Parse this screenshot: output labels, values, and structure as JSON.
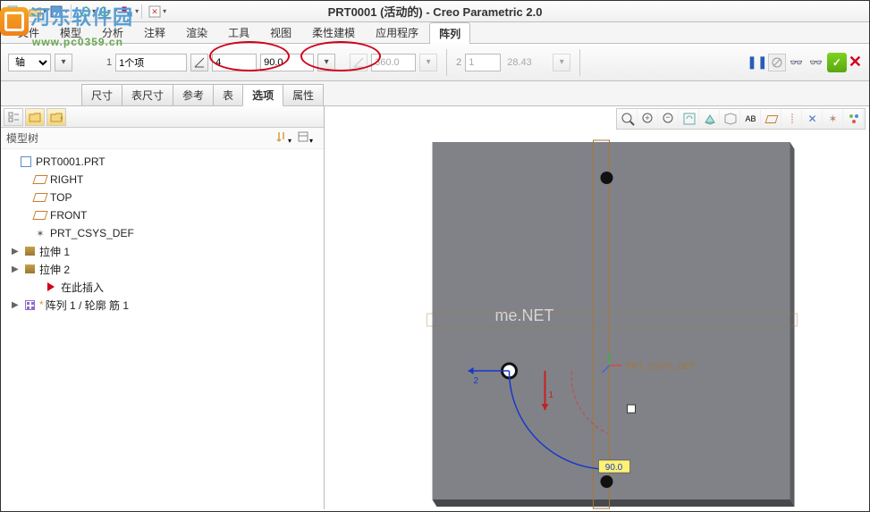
{
  "title": "PRT0001 (活动的) - Creo Parametric 2.0",
  "watermark": {
    "text": "河东软件园",
    "url": "www.pc0359.cn"
  },
  "ribbon_tabs": [
    "文件",
    "模型",
    "分析",
    "注释",
    "渲染",
    "工具",
    "视图",
    "柔性建模",
    "应用程序",
    "阵列"
  ],
  "ribbon_active_index": 9,
  "pattern_bar": {
    "type_label": "轴",
    "dir1_items": "1个项",
    "count1": "4",
    "angle1": "90.0",
    "ext1": "360.0",
    "dir2_count": "1",
    "dir2_val": "28.43",
    "dir1_prefix": "1",
    "dir2_prefix": "2"
  },
  "sub_tabs": [
    "尺寸",
    "表尺寸",
    "参考",
    "表",
    "选项",
    "属性"
  ],
  "sub_active_index": 4,
  "tree": {
    "title": "模型树",
    "items": [
      {
        "icon": "page",
        "label": "PRT0001.PRT",
        "indent": 0
      },
      {
        "icon": "plane",
        "label": "RIGHT",
        "indent": 1
      },
      {
        "icon": "plane",
        "label": "TOP",
        "indent": 1
      },
      {
        "icon": "plane",
        "label": "FRONT",
        "indent": 1
      },
      {
        "icon": "csys",
        "label": "PRT_CSYS_DEF",
        "indent": 1
      },
      {
        "icon": "ext",
        "label": "拉伸 1",
        "indent": 1,
        "expand": "▶"
      },
      {
        "icon": "ext",
        "label": "拉伸 2",
        "indent": 1,
        "expand": "▶"
      },
      {
        "icon": "arrow",
        "label": "在此插入",
        "indent": 2
      },
      {
        "icon": "pat",
        "label": "阵列 1 / 轮廓 筋 1",
        "indent": 1,
        "expand": "▶",
        "star": "*"
      }
    ]
  },
  "viewport": {
    "csys_label": "PRT_CSYS_DEF",
    "dim_angle": "90.0",
    "axis1": "1",
    "axis2": "2",
    "wm": "me.NET"
  }
}
